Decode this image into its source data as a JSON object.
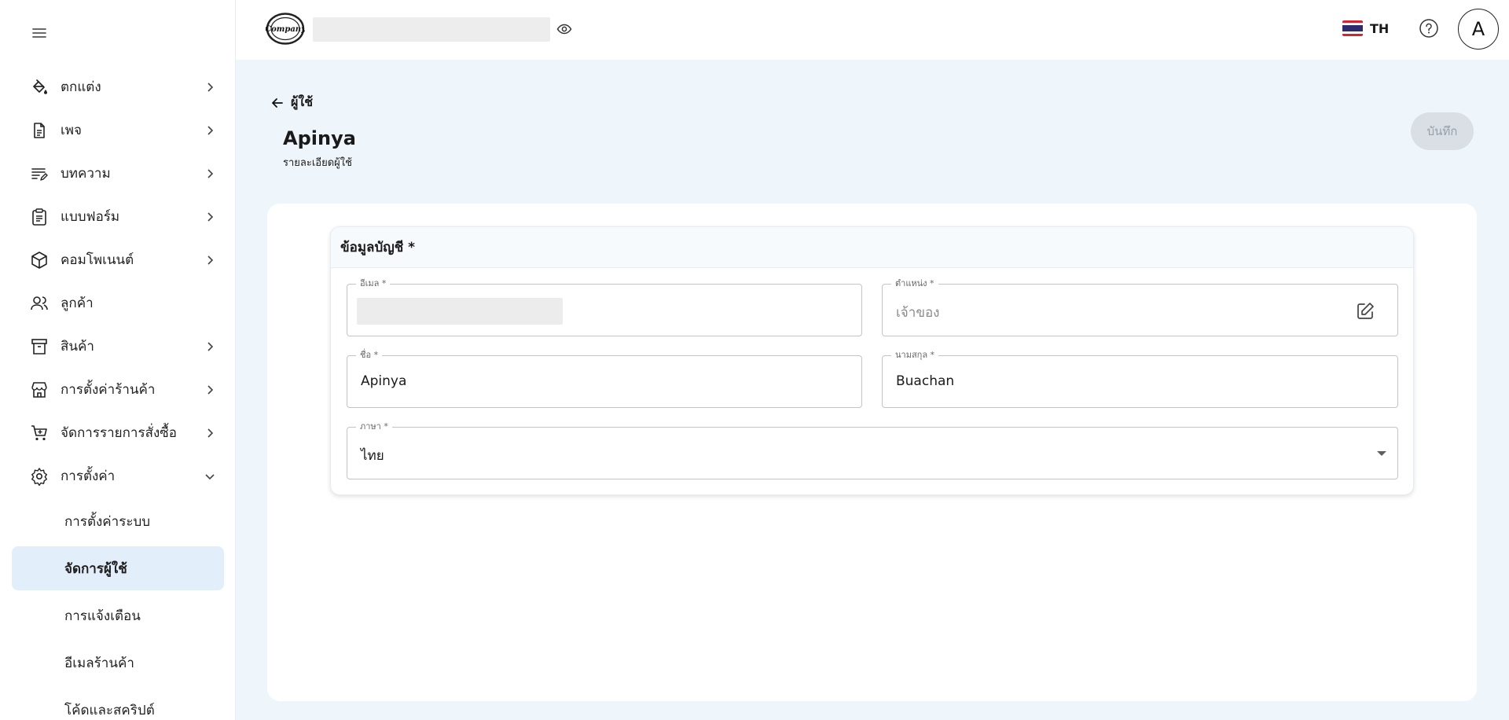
{
  "sidebar": {
    "items": [
      {
        "label": "ตกแต่ง",
        "icon": "paint-bucket-icon",
        "has_chevron": true
      },
      {
        "label": "เพจ",
        "icon": "page-icon",
        "has_chevron": true
      },
      {
        "label": "บทความ",
        "icon": "article-icon",
        "has_chevron": true
      },
      {
        "label": "แบบฟอร์ม",
        "icon": "form-icon",
        "has_chevron": true
      },
      {
        "label": "คอมโพเนนต์",
        "icon": "component-icon",
        "has_chevron": true
      },
      {
        "label": "ลูกค้า",
        "icon": "customers-icon",
        "has_chevron": false
      },
      {
        "label": "สินค้า",
        "icon": "product-icon",
        "has_chevron": true
      },
      {
        "label": "การตั้งค่าร้านค้า",
        "icon": "store-icon",
        "has_chevron": true
      },
      {
        "label": "จัดการรายการสั่งซื้อ",
        "icon": "cart-icon",
        "has_chevron": true
      },
      {
        "label": "การตั้งค่า",
        "icon": "gear-icon",
        "has_chevron": true,
        "expanded": true
      }
    ],
    "sub_items": [
      {
        "label": "การตั้งค่าระบบ",
        "active": false
      },
      {
        "label": "จัดการผู้ใช้",
        "active": true
      },
      {
        "label": "การแจ้งเตือน",
        "active": false
      },
      {
        "label": "อีเมลร้านค้า",
        "active": false
      },
      {
        "label": "โค้ดและสคริปต์",
        "active": false
      }
    ]
  },
  "header": {
    "logo_text": "Company",
    "language": "TH",
    "avatar_letter": "A"
  },
  "main": {
    "back_label": "ผู้ใช้",
    "title": "Apinya",
    "subtitle": "รายละเอียดผู้ใช้",
    "save_label": "บันทึก",
    "card": {
      "title": "ข้อมูลบัญชี *",
      "fields": {
        "email": {
          "label": "อีเมล *",
          "value": ""
        },
        "position": {
          "label": "ตำแหน่ง *",
          "value": "เจ้าของ"
        },
        "first_name": {
          "label": "ชื่อ *",
          "value": "Apinya"
        },
        "last_name": {
          "label": "นามสกุล *",
          "value": "Buachan"
        },
        "language": {
          "label": "ภาษา *",
          "value": "ไทย"
        }
      }
    }
  },
  "colors": {
    "active_bg": "#e2effb",
    "main_bg": "#eef6fb",
    "save_disabled_bg": "#d9dfe4",
    "flag_red": "#d8232f",
    "flag_blue": "#2d2a6e"
  }
}
